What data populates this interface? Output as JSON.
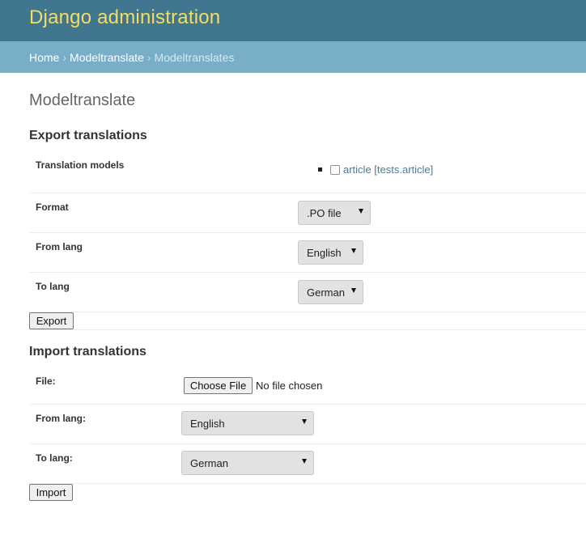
{
  "header": {
    "site_name": "Django administration"
  },
  "breadcrumbs": {
    "home": "Home",
    "app": "Modeltranslate",
    "current": "Modeltranslates",
    "separator": "›"
  },
  "page": {
    "title": "Modeltranslate"
  },
  "export": {
    "title": "Export translations",
    "translation_models_label": "Translation models",
    "model_option": {
      "label": "article [tests.article]",
      "checked": false
    },
    "format": {
      "label": "Format",
      "value": ".PO file"
    },
    "from_lang": {
      "label": "From lang",
      "value": "English"
    },
    "to_lang": {
      "label": "To lang",
      "value": "German"
    },
    "button": "Export"
  },
  "import": {
    "title": "Import translations",
    "file": {
      "label": "File:",
      "button": "Choose File",
      "status": "No file chosen"
    },
    "from_lang": {
      "label": "From lang:",
      "value": "English"
    },
    "to_lang": {
      "label": "To lang:",
      "value": "German"
    },
    "button": "Import"
  },
  "colors": {
    "header_bg": "#417690",
    "site_name": "#f5dd5d",
    "breadcrumbs_bg": "#79aec8",
    "link": "#447e9b"
  }
}
